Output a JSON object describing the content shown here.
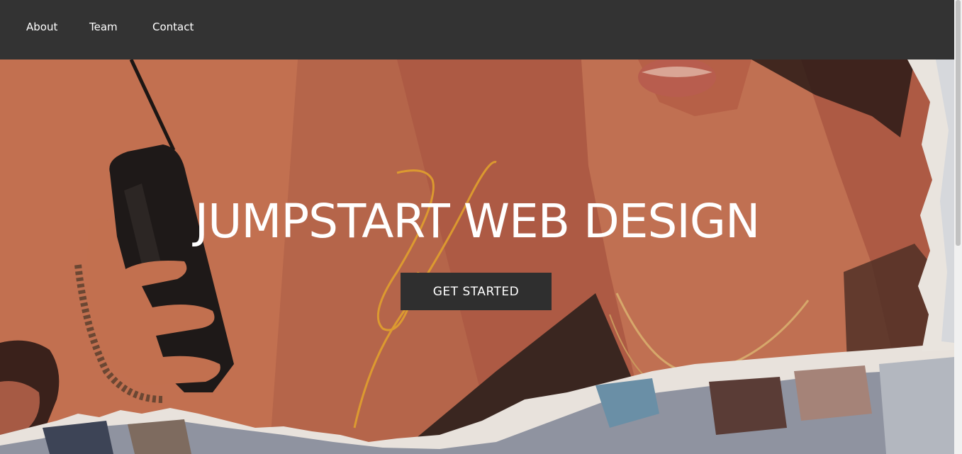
{
  "nav": {
    "items": [
      {
        "label": "About"
      },
      {
        "label": "Team"
      },
      {
        "label": "Contact"
      }
    ]
  },
  "hero": {
    "title": "JUMPSTART WEB DESIGN",
    "cta_label": "GET STARTED"
  },
  "colors": {
    "navbar": "#333333",
    "button": "#2f2f2f",
    "text": "#ffffff",
    "hero_tone": "#b45f44"
  },
  "icons": [
    "hero-background-image"
  ]
}
